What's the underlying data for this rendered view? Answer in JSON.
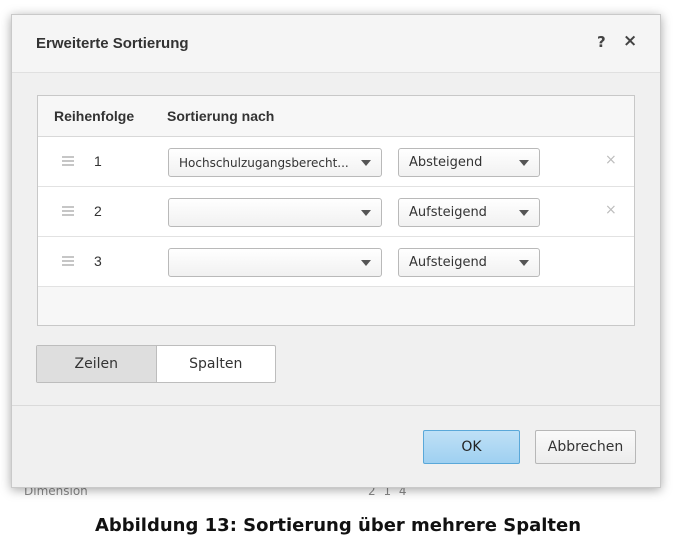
{
  "backdrop": {
    "label": "Dimension",
    "numbers": "2  1  4"
  },
  "dialog": {
    "title": "Erweiterte Sortierung",
    "help_icon": "?",
    "close_icon": "×"
  },
  "table": {
    "headers": {
      "order": "Reihenfolge",
      "sort_by": "Sortierung nach"
    },
    "rows": [
      {
        "num": "1",
        "field": "Hochschulzugangsberecht...",
        "direction": "Absteigend",
        "removable": true
      },
      {
        "num": "2",
        "field": "",
        "direction": "Aufsteigend",
        "removable": true
      },
      {
        "num": "3",
        "field": "",
        "direction": "Aufsteigend",
        "removable": false
      }
    ],
    "remove_icon": "×"
  },
  "toggle": {
    "rows_label": "Zeilen",
    "columns_label": "Spalten",
    "active": "Zeilen"
  },
  "buttons": {
    "ok": "OK",
    "cancel": "Abbrechen"
  },
  "caption": "Abbildung 13: Sortierung über mehrere Spalten",
  "colors": {
    "ok_button": "#9fd0f1",
    "dialog_bg": "#f0f0f0"
  }
}
